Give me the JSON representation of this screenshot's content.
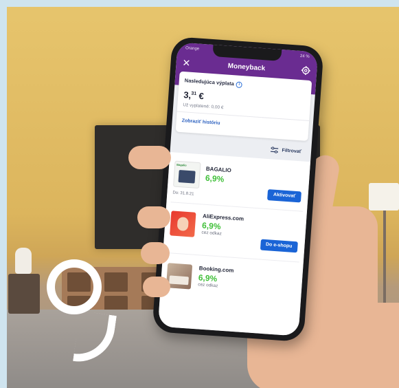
{
  "status": {
    "carrier": "Orange",
    "battery": "24 %"
  },
  "header": {
    "title": "Moneyback"
  },
  "summary": {
    "label": "Nasledujúca výplata",
    "amount_main": "3,",
    "amount_sup": "31",
    "amount_currency": "€",
    "paid_label": "Už vyplatené: 0,00 €",
    "history_link": "Zobraziť históriu"
  },
  "filter": {
    "label": "Filtrovať"
  },
  "items": [
    {
      "name": "BAGALIO",
      "rate": "6,9%",
      "sub": "",
      "date": "Do: 31.8.21",
      "button": "Aktivovať",
      "thumb_label": "Bagalio"
    },
    {
      "name": "AliExpress.com",
      "rate": "6,9%",
      "sub": "cez odkaz",
      "date": "",
      "button": "Do e-shopu"
    },
    {
      "name": "Booking.com",
      "rate": "6,9%",
      "sub": "cez odkaz",
      "date": "",
      "button": ""
    }
  ],
  "colors": {
    "brand": "#6a2c91",
    "accent_button": "#1a64d6",
    "rate_green": "#3fbf38"
  }
}
